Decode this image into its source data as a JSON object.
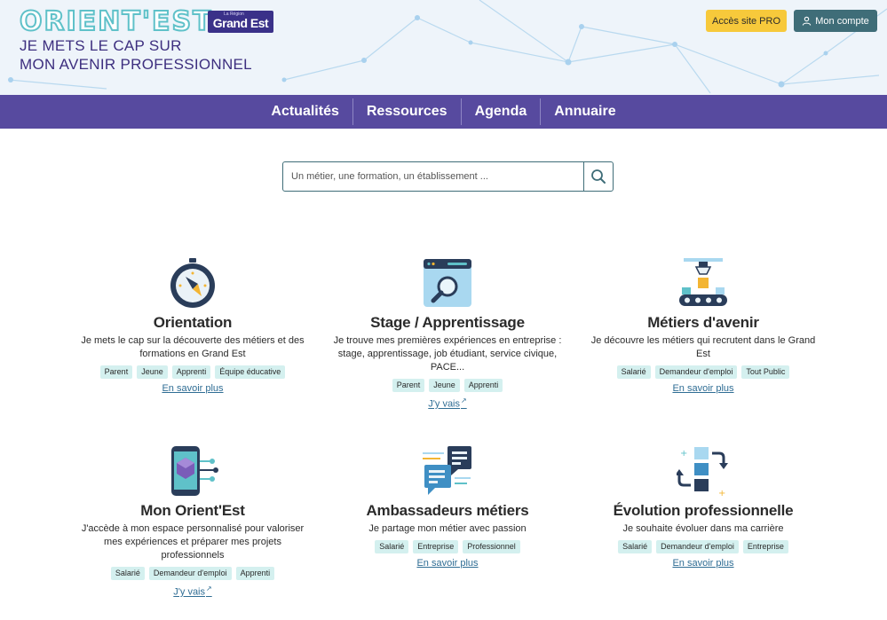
{
  "header": {
    "logo": "ORIENT'EST",
    "region_small": "La Région",
    "region_big": "Grand Est",
    "tagline_line1": "JE METS LE CAP SUR",
    "tagline_line2": "MON AVENIR PROFESSIONNEL",
    "pro_label": "Accès site PRO",
    "account_label": "Mon compte"
  },
  "nav": {
    "items": [
      "Actualités",
      "Ressources",
      "Agenda",
      "Annuaire"
    ]
  },
  "search": {
    "placeholder": "Un métier, une formation, un établissement ..."
  },
  "cards": [
    {
      "title": "Orientation",
      "desc": "Je mets le cap sur la découverte des métiers et des formations en Grand Est",
      "tags": [
        "Parent",
        "Jeune",
        "Apprenti",
        "Équipe éducative"
      ],
      "link": "En savoir plus",
      "icon": "compass-icon"
    },
    {
      "title": "Stage / Apprentissage",
      "desc": "Je trouve mes premières expériences en entreprise : stage, apprentissage, job étudiant, service civique, PACE...",
      "tags": [
        "Parent",
        "Jeune",
        "Apprenti"
      ],
      "link": "J'y vais",
      "icon": "browser-magnifier-icon"
    },
    {
      "title": "Métiers d'avenir",
      "desc": "Je découvre les métiers qui recrutent dans le Grand Est",
      "tags": [
        "Salarié",
        "Demandeur d'emploi",
        "Tout Public"
      ],
      "link": "En savoir plus",
      "icon": "robotic-arm-icon"
    },
    {
      "title": "Mon Orient'Est",
      "desc": "J'accède à mon espace personnalisé pour valoriser mes expériences et préparer mes projets professionnels",
      "tags": [
        "Salarié",
        "Demandeur d'emploi",
        "Apprenti"
      ],
      "link": "J'y vais",
      "icon": "smartphone-cube-icon"
    },
    {
      "title": "Ambassadeurs métiers",
      "desc": "Je partage mon métier avec passion",
      "tags": [
        "Salarié",
        "Entreprise",
        "Professionnel"
      ],
      "link": "En savoir plus",
      "icon": "chat-bubbles-icon"
    },
    {
      "title": "Évolution professionnelle",
      "desc": "Je souhaite évoluer dans ma carrière",
      "tags": [
        "Salarié",
        "Demandeur d'emploi",
        "Entreprise"
      ],
      "link": "En savoir plus",
      "icon": "career-arrows-icon"
    }
  ],
  "colors": {
    "nav_bg": "#574a9f",
    "pro_button": "#f7c93b",
    "account_button": "#3f6d78",
    "tag_bg": "#d4f0ef",
    "link": "#2f6d94"
  }
}
